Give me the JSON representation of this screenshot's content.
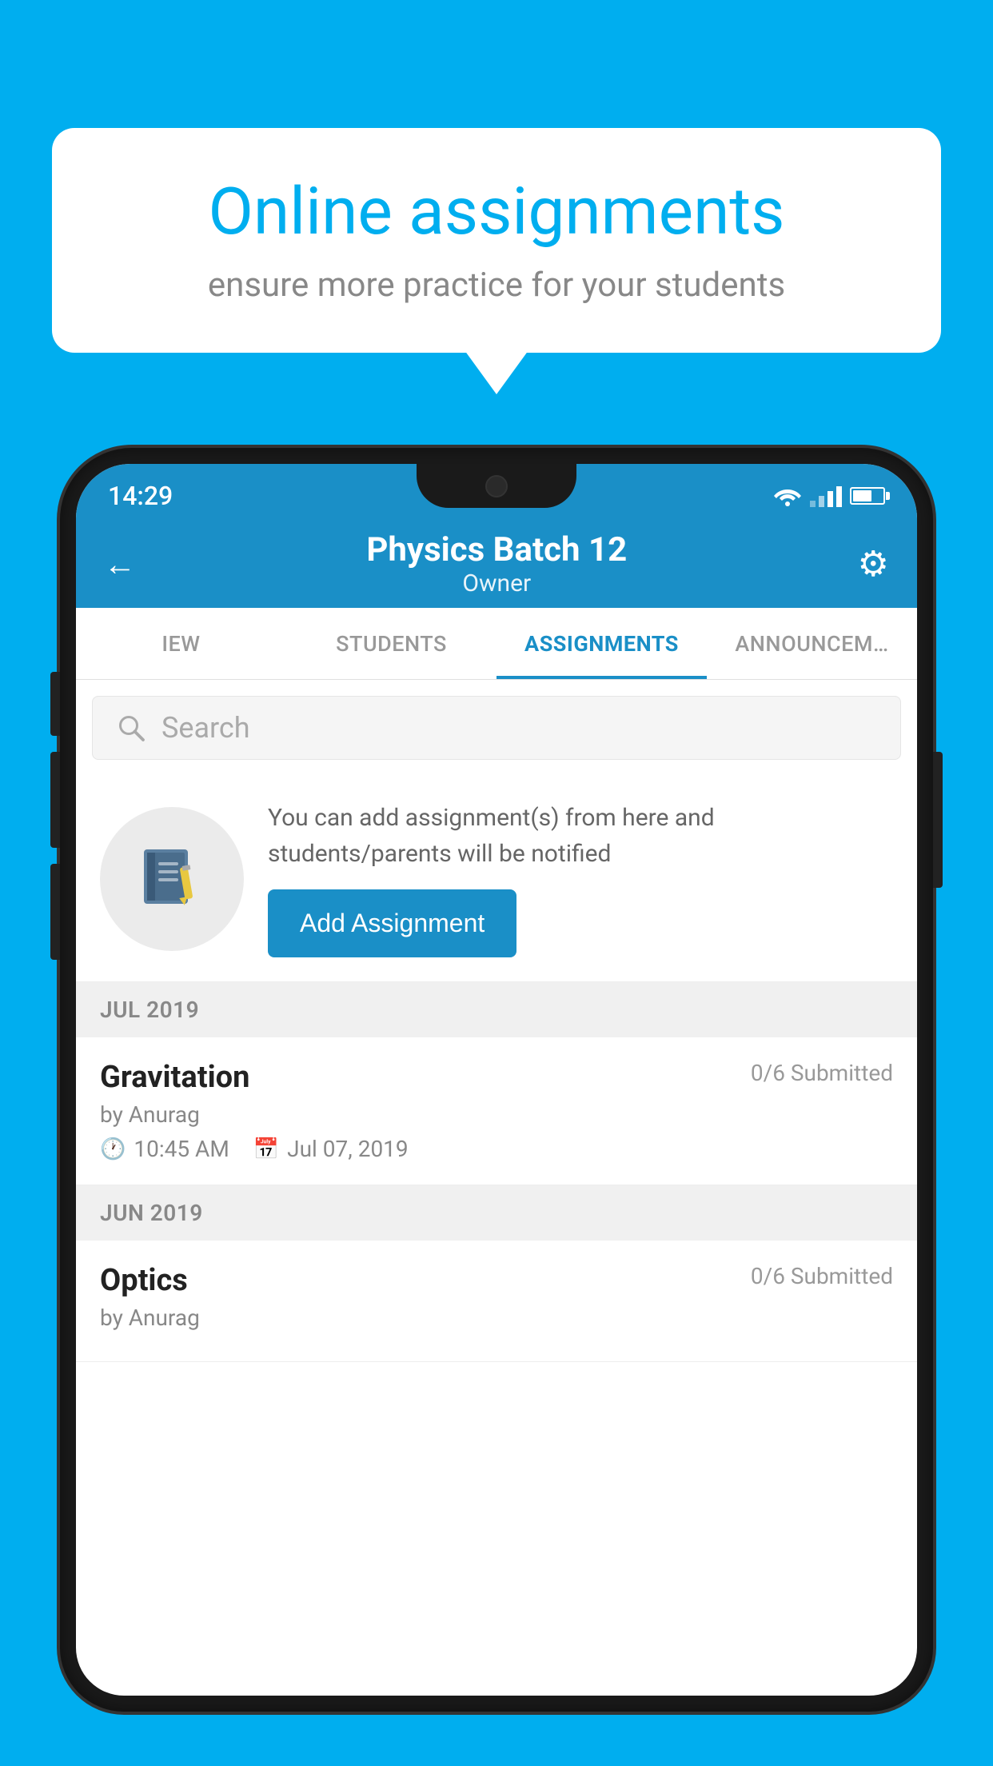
{
  "background_color": "#00AEEF",
  "speech_bubble": {
    "title": "Online assignments",
    "subtitle": "ensure more practice for your students"
  },
  "status_bar": {
    "time": "14:29",
    "icons": [
      "wifi",
      "signal",
      "battery"
    ]
  },
  "app_header": {
    "title": "Physics Batch 12",
    "subtitle": "Owner",
    "back_label": "←",
    "settings_label": "⚙"
  },
  "tabs": [
    {
      "id": "iew",
      "label": "IEW",
      "active": false
    },
    {
      "id": "students",
      "label": "STUDENTS",
      "active": false
    },
    {
      "id": "assignments",
      "label": "ASSIGNMENTS",
      "active": true
    },
    {
      "id": "announcements",
      "label": "ANNOUNCEM…",
      "active": false
    }
  ],
  "search": {
    "placeholder": "Search"
  },
  "info_card": {
    "description": "You can add assignment(s) from here and students/parents will be notified",
    "button_label": "Add Assignment"
  },
  "sections": [
    {
      "header": "JUL 2019",
      "assignments": [
        {
          "name": "Gravitation",
          "submitted": "0/6 Submitted",
          "by": "by Anurag",
          "time": "10:45 AM",
          "date": "Jul 07, 2019"
        }
      ]
    },
    {
      "header": "JUN 2019",
      "assignments": [
        {
          "name": "Optics",
          "submitted": "0/6 Submitted",
          "by": "by Anurag",
          "time": "",
          "date": ""
        }
      ]
    }
  ]
}
